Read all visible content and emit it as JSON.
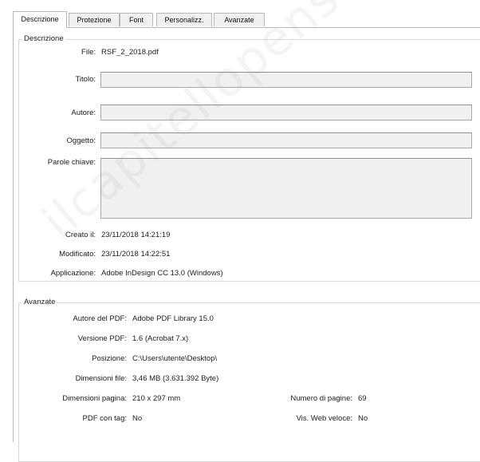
{
  "tabs": [
    {
      "label": "Descrizione"
    },
    {
      "label": "Protezione"
    },
    {
      "label": "Font"
    },
    {
      "label": "Personalizz."
    },
    {
      "label": "Avanzate"
    }
  ],
  "description": {
    "group_title": "Descrizione",
    "file_label": "File:",
    "file_value": "RSF_2_2018.pdf",
    "title_label": "Titolo:",
    "title_value": "",
    "author_label": "Autore:",
    "author_value": "",
    "subject_label": "Oggetto:",
    "subject_value": "",
    "keywords_label": "Parole chiave:",
    "keywords_value": "",
    "created_label": "Creato il:",
    "created_value": "23/11/2018 14:21:19",
    "modified_label": "Modificato:",
    "modified_value": "23/11/2018 14:22:51",
    "application_label": "Applicazione:",
    "application_value": "Adobe InDesign CC 13.0 (Windows)"
  },
  "advanced": {
    "group_title": "Avanzate",
    "producer_label": "Autore del PDF:",
    "producer_value": "Adobe PDF Library 15.0",
    "version_label": "Versione PDF:",
    "version_value": "1.6 (Acrobat 7.x)",
    "location_label": "Posizione:",
    "location_value": "C:\\Users\\utente\\Desktop\\",
    "filesize_label": "Dimensioni file:",
    "filesize_value": "3,46 MB (3.631.392 Byte)",
    "pagesize_label": "Dimensioni pagina:",
    "pagesize_value": "210 x 297 mm",
    "pagecount_label": "Numero di pagine:",
    "pagecount_value": "69",
    "tagged_label": "PDF con tag:",
    "tagged_value": "No",
    "fastweb_label": "Vis. Web veloce:",
    "fastweb_value": "No"
  },
  "watermark": "ilcapitellopensatore.it"
}
